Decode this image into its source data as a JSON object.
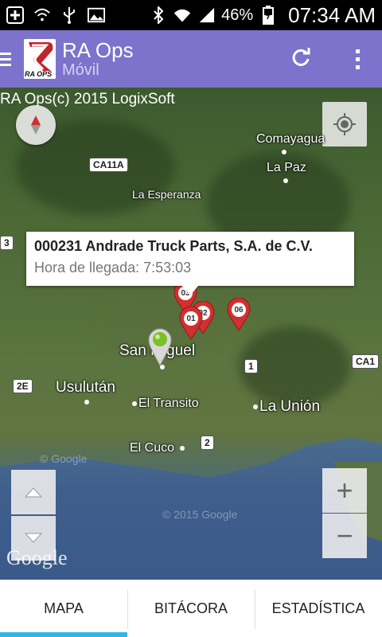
{
  "status_bar": {
    "battery": "46%",
    "time": "07:34 AM",
    "icons": [
      "add-icon",
      "wifi-question-icon",
      "usb-icon",
      "image-icon",
      "bluetooth-icon",
      "wifi-icon",
      "signal-icon",
      "battery-icon"
    ]
  },
  "action_bar": {
    "title": "RA Ops",
    "subtitle": "Móvil",
    "logo_text": "RA OPS",
    "bg_color": "#7d73cd"
  },
  "map": {
    "copyright": "RA Ops(c) 2015 LogixSoft",
    "places": {
      "comayagua": "Comayagua",
      "la_paz": "La Paz",
      "la_esperanza": "La Esperanza",
      "san_miguel": "San Miguel",
      "usulutan": "Usulután",
      "el_transito": "El Transito",
      "la_union": "La Unión",
      "el_cuco": "El Cuco"
    },
    "shields": {
      "ca11a": "CA11A",
      "r3": "3",
      "r1": "1",
      "ca1": "CA1",
      "r2e": "2E",
      "r2": "2"
    },
    "info_window": {
      "title": "000231 Andrade Truck Parts, S.A. de C.V.",
      "subtitle": "Hora de llegada: 7:53:03"
    },
    "markers": {
      "m03": "03",
      "m01": "01",
      "m02": "02",
      "m06": "06"
    },
    "google_logo": "Google",
    "watermark1": "© Google",
    "watermark2": "© 2015 Google",
    "zoom_in": "+",
    "zoom_out": "−"
  },
  "tabs": {
    "mapa": "MAPA",
    "bitacora": "BITÁCORA",
    "estadistica": "ESTADÍSTICA",
    "active": "MAPA",
    "active_color": "#33b5e5"
  }
}
